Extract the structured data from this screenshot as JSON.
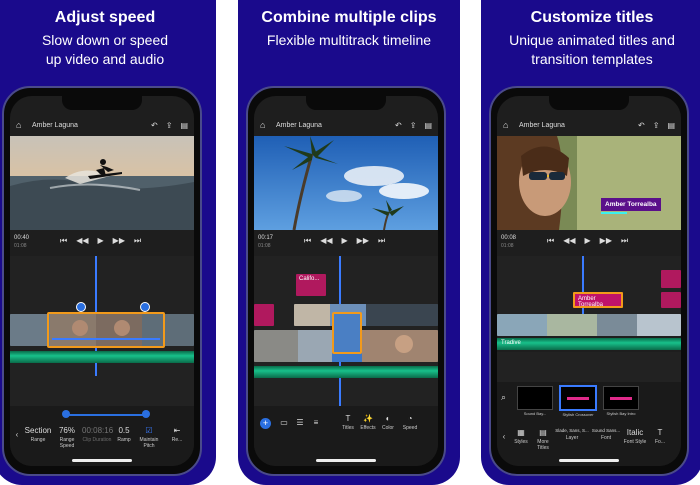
{
  "panels": [
    {
      "headline": "Adjust speed",
      "sub1": "Slow down or speed",
      "sub2": "up video and audio",
      "project": "Amber Laguna",
      "time_current": "00:40",
      "time_frames": "18",
      "time_total": "01:08",
      "time_total_frames": "18",
      "tools": [
        {
          "value": "Section",
          "label": "Range"
        },
        {
          "value": "76%",
          "label": "Range Speed"
        },
        {
          "value": "00:08:16",
          "label": "Clip Duration"
        },
        {
          "value": "0.5",
          "label": "Ramp"
        },
        {
          "value": "☑",
          "label": "Maintain Pitch"
        },
        {
          "value": "⇤",
          "label": "Re..."
        }
      ]
    },
    {
      "headline": "Combine multiple clips",
      "sub1": "Flexible multitrack timeline",
      "project": "Amber Laguna",
      "time_current": "00:17",
      "time_frames": "18",
      "time_total": "01:08",
      "time_total_frames": "18",
      "title_clip": "Califo...",
      "toolbar": [
        {
          "icon": "T",
          "label": "Titles"
        },
        {
          "icon": "✨",
          "label": "Effects"
        },
        {
          "icon": "◐",
          "label": "Color"
        },
        {
          "icon": "◔",
          "label": "Speed"
        }
      ]
    },
    {
      "headline": "Customize titles",
      "sub1": "Unique animated titles and",
      "sub2": "transition templates",
      "project": "Amber Laguna",
      "overlay_title": "Amber Torrealba",
      "time_current": "00:08",
      "time_frames": "18",
      "time_total": "01:08",
      "time_total_frames": "18",
      "title_clip": "Amber Torrealba",
      "track_label": "Tradive",
      "templates": [
        "Sound Bay...",
        "Stylish Crossover",
        "Stylish Bay Intro"
      ],
      "tools": [
        {
          "value": "▦",
          "label": "Styles"
        },
        {
          "value": "▤",
          "label": "More Titles"
        },
        {
          "value": "Slade, Sans, S...",
          "label": "Layer"
        },
        {
          "value": "Sound Sans...",
          "label": "Font"
        },
        {
          "value": "Italic",
          "label": "Font Style"
        },
        {
          "value": "T",
          "label": "Fo..."
        }
      ]
    }
  ]
}
